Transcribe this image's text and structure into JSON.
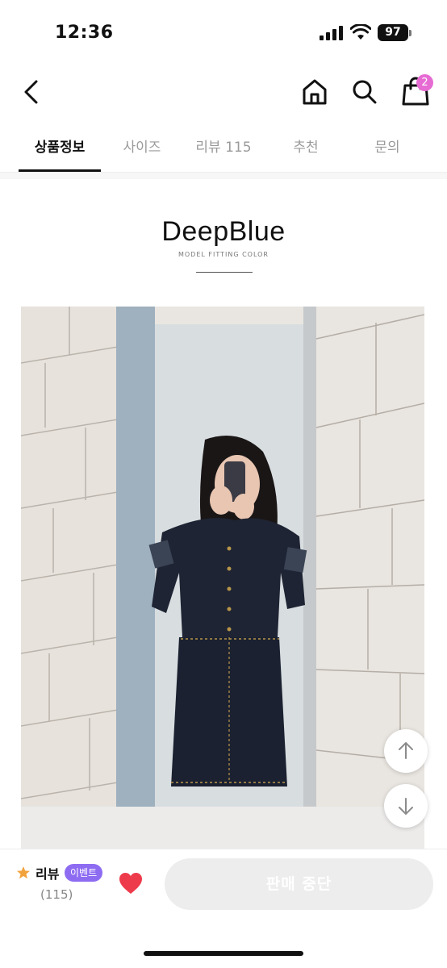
{
  "status_bar": {
    "time": "12:36",
    "battery": "97"
  },
  "nav": {
    "back_icon": "chevron-left-icon",
    "home_icon": "home-icon",
    "search_icon": "search-icon",
    "cart_icon": "shopping-bag-icon",
    "cart_badge": "2",
    "badge_color": "#e66bd3"
  },
  "tabs": [
    {
      "label": "상품정보",
      "active": true
    },
    {
      "label": "사이즈",
      "active": false
    },
    {
      "label": "리뷰 115",
      "active": false
    },
    {
      "label": "추천",
      "active": false
    },
    {
      "label": "문의",
      "active": false
    }
  ],
  "content": {
    "brand_title": "DeepBlue",
    "brand_subtitle": "MODEL FITTING COLOR"
  },
  "scroll_buttons": {
    "up_icon": "arrow-up-icon",
    "down_icon": "arrow-down-icon"
  },
  "bottom_bar": {
    "review_label": "리뷰",
    "event_badge": "이벤트",
    "review_count": "(115)",
    "buy_button": "판매 중단",
    "heart_color": "#ee3b4b",
    "event_color": "#8e6cf2"
  }
}
